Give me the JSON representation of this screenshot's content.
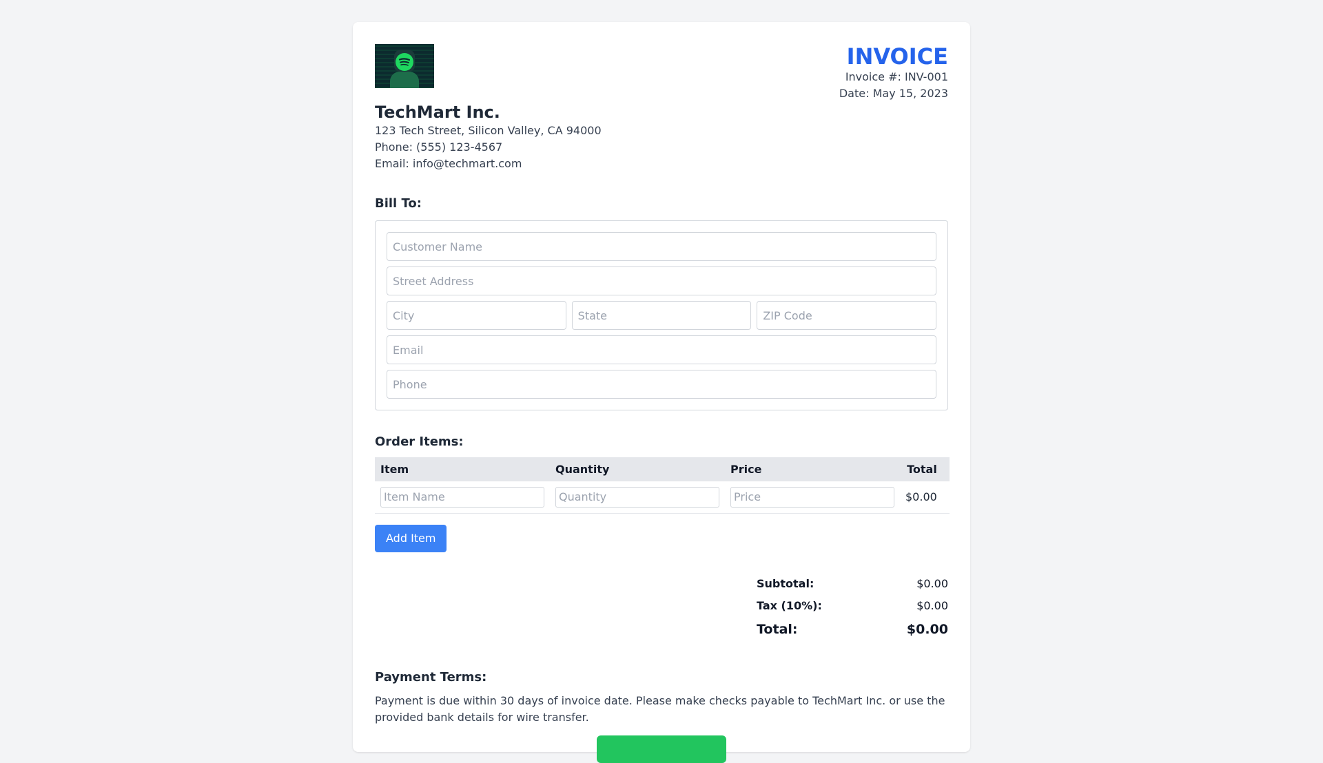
{
  "company": {
    "logo_icon": "spotify-logo-icon",
    "name": "TechMart Inc.",
    "address": "123 Tech Street, Silicon Valley, CA 94000",
    "phone": "Phone: (555) 123-4567",
    "email": "Email: info@techmart.com"
  },
  "invoice": {
    "title": "INVOICE",
    "number": "Invoice #: INV-001",
    "date": "Date: May 15, 2023"
  },
  "bill_to": {
    "title": "Bill To:",
    "customer_name_placeholder": "Customer Name",
    "street_placeholder": "Street Address",
    "city_placeholder": "City",
    "state_placeholder": "State",
    "zip_placeholder": "ZIP Code",
    "email_placeholder": "Email",
    "phone_placeholder": "Phone"
  },
  "order": {
    "title": "Order Items:",
    "columns": [
      "Item",
      "Quantity",
      "Price",
      "Total"
    ],
    "rows": [
      {
        "item_placeholder": "Item Name",
        "quantity_placeholder": "Quantity",
        "price_placeholder": "Price",
        "total": "$0.00"
      }
    ],
    "add_button": "Add Item"
  },
  "totals": {
    "subtotal_label": "Subtotal:",
    "subtotal_value": "$0.00",
    "tax_label": "Tax (10%):",
    "tax_value": "$0.00",
    "total_label": "Total:",
    "total_value": "$0.00"
  },
  "terms": {
    "title": "Payment Terms:",
    "text": "Payment is due within 30 days of invoice date. Please make checks payable to TechMart Inc. or use the provided bank details for wire transfer."
  },
  "colors": {
    "accent": "#2563eb",
    "button_blue": "#3b82f6",
    "button_green": "#22c55e",
    "background": "#f3f4f6"
  }
}
